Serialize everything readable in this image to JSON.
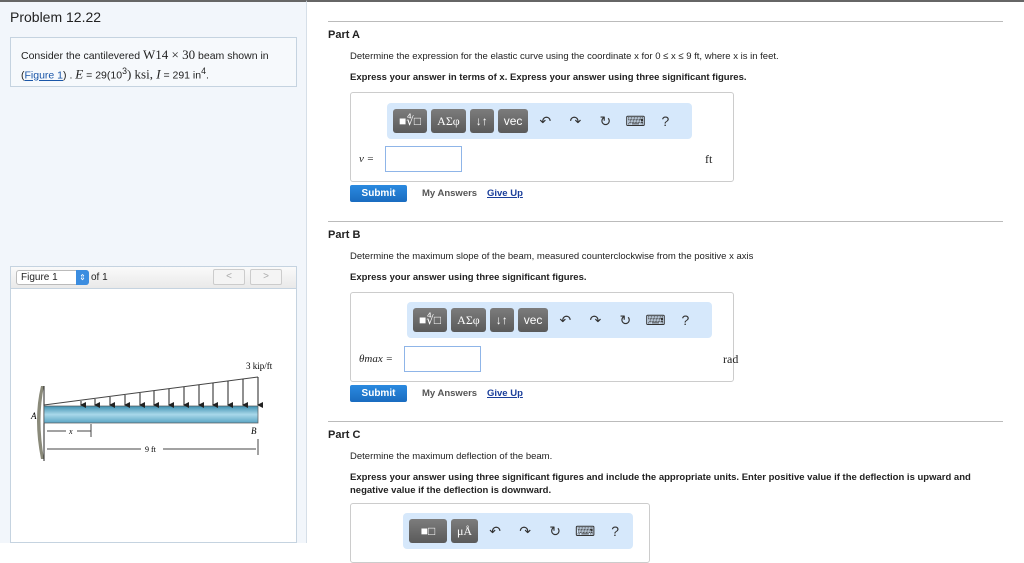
{
  "problem": {
    "title": "Problem 12.22",
    "text_pre": "Consider the cantilevered ",
    "beam": "W14 × 30",
    "text_mid": " beam shown in",
    "figure_link": "Figure 1",
    "E_label": "E",
    "E_val": " = 29(10",
    "E_exp": "3",
    "E_unit": ") ksi, ",
    "I_label": "I",
    "I_val": " = 291 in",
    "I_exp": "4",
    "end": "."
  },
  "figure": {
    "select_value": "Figure 1",
    "of_label": "of 1",
    "prev": "<",
    "next": ">",
    "load_label": "3 kip/ft",
    "point_a": "A",
    "point_b": "B",
    "x_label": "x",
    "length_label": "9 ft"
  },
  "toolbar": {
    "templates": "■∜□",
    "greek": "ΑΣφ",
    "arrows": "↓↑",
    "vec": "vec",
    "undo": "↶",
    "redo": "↷",
    "reset": "↻",
    "keyboard": "⌨",
    "help": "?",
    "templates_c": "■□",
    "units_c": "μÅ"
  },
  "partA": {
    "label": "Part A",
    "question": "Determine the expression for the elastic curve using the coordinate x for 0 ≤ x ≤ 9 ft, where x is in feet.",
    "instruction": "Express your answer in terms of x. Express your answer using three significant figures.",
    "var": "v =",
    "value": "",
    "unit": "ft",
    "submit": "Submit",
    "my_answers": "My Answers",
    "give_up": "Give Up"
  },
  "partB": {
    "label": "Part B",
    "question": "Determine the maximum slope of the beam, measured counterclockwise from the positive x axis",
    "instruction": "Express your answer using three significant figures.",
    "var": "θmax =",
    "value": "",
    "unit": "rad",
    "submit": "Submit",
    "my_answers": "My Answers",
    "give_up": "Give Up"
  },
  "partC": {
    "label": "Part C",
    "question": "Determine the maximum deflection of the beam.",
    "instruction": "Express your answer using three significant figures and include the appropriate units. Enter positive value if the deflection is upward and negative value if the deflection is downward."
  }
}
